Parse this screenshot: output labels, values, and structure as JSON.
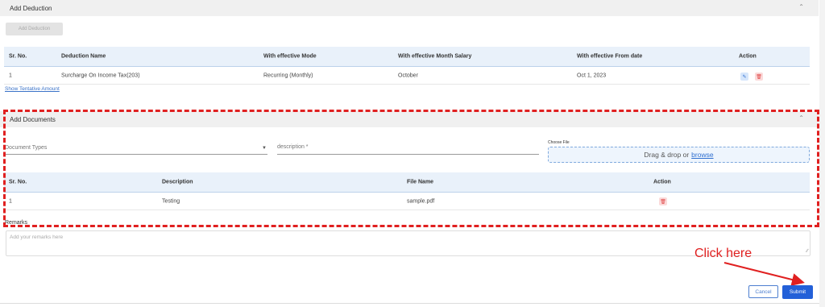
{
  "deduction_section": {
    "title": "Add Deduction",
    "add_button": "Add Deduction",
    "headers": [
      "Sr. No.",
      "Deduction Name",
      "With effective Mode",
      "With effective Month Salary",
      "With effective From date",
      "Action"
    ],
    "rows": [
      {
        "sr": "1",
        "name": "Surcharge On Income Tax(203)",
        "mode": "Recurring (Monthly)",
        "month": "October",
        "from_date": "Oct 1, 2023"
      }
    ],
    "show_tentative_link": "Show Tentative Amount"
  },
  "documents_section": {
    "title": "Add Documents",
    "document_types_label": "Document Types",
    "description_label": "description *",
    "choose_file_label": "Choose File",
    "dropzone_text": "Drag & drop or",
    "browse_link": "browse",
    "headers": [
      "Sr. No.",
      "Description",
      "File Name",
      "Action"
    ],
    "rows": [
      {
        "sr": "1",
        "description": "Testing",
        "file_name": "sample.pdf"
      }
    ]
  },
  "remarks": {
    "label": "Remarks",
    "placeholder": "Add your remarks here"
  },
  "annotation": {
    "text": "Click here",
    "color": "#e02020"
  },
  "footer": {
    "cancel_label": "Cancel",
    "submit_label": "Submit"
  },
  "icons": {
    "collapse": "chevron-up-icon",
    "edit": "edit-icon",
    "delete": "trash-icon",
    "dropdown": "chevron-down-icon",
    "resize": "resize-grip-icon"
  },
  "colors": {
    "accent": "#2360d8",
    "link": "#3b73c8",
    "delete": "#e04848",
    "table_header_bg": "#e9f1fa"
  }
}
